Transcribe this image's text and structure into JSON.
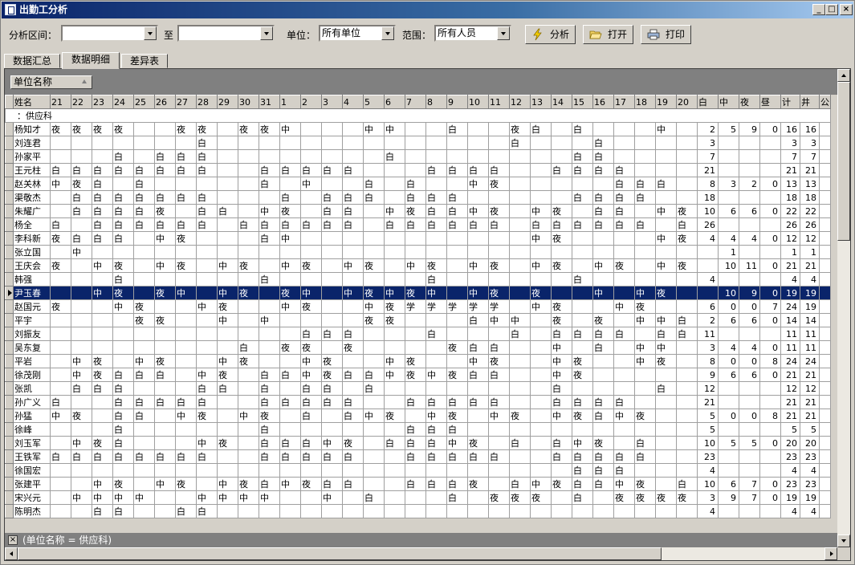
{
  "window": {
    "title": "出勤工分析",
    "minimize": "_",
    "maximize": "□",
    "close": "×"
  },
  "toolbar": {
    "range_label": "分析区间：",
    "range_to": "至",
    "range_start": "",
    "range_end": "",
    "unit_label": "单位：",
    "unit_value": "所有单位",
    "scope_label": "范围：",
    "scope_value": "所有人员",
    "analyze_label": "分析",
    "open_label": "打开",
    "print_label": "打印"
  },
  "tabs": [
    "数据汇总",
    "数据明细",
    "差异表"
  ],
  "active_tab": 1,
  "group": {
    "field": "单位名称",
    "group_row": "：供应科"
  },
  "columns": [
    "姓名",
    "21",
    "22",
    "23",
    "24",
    "25",
    "26",
    "27",
    "28",
    "29",
    "30",
    "31",
    "1",
    "2",
    "3",
    "4",
    "5",
    "6",
    "7",
    "8",
    "9",
    "10",
    "11",
    "12",
    "13",
    "14",
    "15",
    "16",
    "17",
    "18",
    "19",
    "20",
    "白",
    "中",
    "夜",
    "昼",
    "计",
    "井",
    "公"
  ],
  "rows": [
    [
      "杨知才",
      "夜",
      "夜",
      "夜",
      "夜",
      "",
      "",
      "夜",
      "夜",
      "",
      "夜",
      "夜",
      "中",
      "",
      "",
      "",
      "中",
      "中",
      "",
      "",
      "白",
      "",
      "",
      "夜",
      "白",
      "",
      "白",
      "",
      "",
      "",
      "中",
      "",
      "2",
      "5",
      "9",
      "0",
      "16",
      "16",
      ""
    ],
    [
      "刘连君",
      "",
      "",
      "",
      "",
      "",
      "",
      "",
      "白",
      "",
      "",
      "",
      "",
      "",
      "",
      "",
      "",
      "",
      "",
      "",
      "",
      "",
      "",
      "白",
      "",
      "",
      "",
      "白",
      "",
      "",
      "",
      "",
      "3",
      "",
      "",
      "",
      "3",
      "3",
      ""
    ],
    [
      "孙家平",
      "",
      "",
      "",
      "白",
      "",
      "白",
      "白",
      "白",
      "",
      "",
      "",
      "",
      "",
      "",
      "",
      "",
      "白",
      "",
      "",
      "",
      "",
      "",
      "",
      "",
      "",
      "白",
      "白",
      "",
      "",
      "",
      "",
      "7",
      "",
      "",
      "",
      "7",
      "7",
      ""
    ],
    [
      "王元柱",
      "白",
      "白",
      "白",
      "白",
      "白",
      "白",
      "白",
      "白",
      "",
      "",
      "白",
      "白",
      "白",
      "白",
      "白",
      "",
      "",
      "",
      "白",
      "白",
      "白",
      "白",
      "",
      "",
      "白",
      "白",
      "白",
      "白",
      "",
      "",
      "",
      "21",
      "",
      "",
      "",
      "21",
      "21",
      ""
    ],
    [
      "赵关林",
      "中",
      "夜",
      "白",
      "",
      "白",
      "",
      "",
      "",
      "",
      "",
      "白",
      "",
      "中",
      "",
      "",
      "白",
      "",
      "白",
      "",
      "",
      "中",
      "夜",
      "",
      "",
      "",
      "",
      "",
      "白",
      "白",
      "白",
      "",
      "8",
      "3",
      "2",
      "0",
      "13",
      "13",
      ""
    ],
    [
      "渠敬杰",
      "",
      "白",
      "白",
      "白",
      "白",
      "白",
      "白",
      "白",
      "",
      "",
      "",
      "白",
      "",
      "白",
      "白",
      "白",
      "",
      "白",
      "白",
      "白",
      "",
      "",
      "",
      "",
      "",
      "白",
      "白",
      "白",
      "白",
      "",
      "",
      "18",
      "",
      "",
      "",
      "18",
      "18",
      ""
    ],
    [
      "朱耀广",
      "",
      "白",
      "白",
      "白",
      "白",
      "夜",
      "",
      "白",
      "白",
      "",
      "中",
      "夜",
      "",
      "白",
      "白",
      "",
      "中",
      "夜",
      "白",
      "白",
      "中",
      "夜",
      "",
      "中",
      "夜",
      "",
      "白",
      "白",
      "",
      "中",
      "夜",
      "10",
      "6",
      "6",
      "0",
      "22",
      "22",
      ""
    ],
    [
      "杨全",
      "白",
      "",
      "白",
      "白",
      "白",
      "白",
      "白",
      "白",
      "",
      "白",
      "白",
      "白",
      "白",
      "白",
      "白",
      "",
      "白",
      "白",
      "白",
      "白",
      "白",
      "白",
      "",
      "白",
      "白",
      "白",
      "白",
      "白",
      "白",
      "",
      "白",
      "26",
      "",
      "",
      "",
      "26",
      "26",
      ""
    ],
    [
      "李科新",
      "夜",
      "白",
      "白",
      "白",
      "",
      "中",
      "夜",
      "",
      "",
      "",
      "白",
      "中",
      "",
      "",
      "",
      "",
      "",
      "",
      "",
      "",
      "",
      "",
      "",
      "中",
      "夜",
      "",
      "",
      "",
      "",
      "中",
      "夜",
      "4",
      "4",
      "4",
      "0",
      "12",
      "12",
      ""
    ],
    [
      "张立国",
      "",
      "中",
      "",
      "",
      "",
      "",
      "",
      "",
      "",
      "",
      "",
      "",
      "",
      "",
      "",
      "",
      "",
      "",
      "",
      "",
      "",
      "",
      "",
      "",
      "",
      "",
      "",
      "",
      "",
      "",
      "",
      "",
      "1",
      "",
      "",
      "1",
      "1",
      ""
    ],
    [
      "王庆会",
      "夜",
      "",
      "中",
      "夜",
      "",
      "中",
      "夜",
      "",
      "中",
      "夜",
      "",
      "中",
      "夜",
      "",
      "中",
      "夜",
      "",
      "中",
      "夜",
      "",
      "中",
      "夜",
      "",
      "中",
      "夜",
      "",
      "中",
      "夜",
      "",
      "中",
      "夜",
      "",
      "10",
      "11",
      "0",
      "21",
      "21",
      ""
    ],
    [
      "韩强",
      "",
      "",
      "",
      "白",
      "",
      "",
      "",
      "",
      "",
      "",
      "白",
      "",
      "",
      "",
      "",
      "",
      "",
      "",
      "白",
      "",
      "",
      "",
      "",
      "",
      "",
      "白",
      "",
      "",
      "",
      "",
      "",
      "4",
      "",
      "",
      "",
      "4",
      "4",
      ""
    ],
    [
      "尹玉春",
      "",
      "",
      "中",
      "夜",
      "",
      "夜",
      "中",
      "",
      "中",
      "夜",
      "",
      "夜",
      "中",
      "",
      "中",
      "夜",
      "中",
      "夜",
      "中",
      "",
      "中",
      "夜",
      "",
      "夜",
      "",
      "",
      "中",
      "",
      "中",
      "夜",
      "",
      "",
      "10",
      "9",
      "0",
      "19",
      "19",
      ""
    ],
    [
      "赵国元",
      "夜",
      "",
      "",
      "中",
      "夜",
      "",
      "",
      "中",
      "夜",
      "",
      "",
      "中",
      "夜",
      "",
      "",
      "中",
      "夜",
      "学",
      "学",
      "学",
      "学",
      "学",
      "",
      "中",
      "夜",
      "",
      "",
      "中",
      "夜",
      "",
      "",
      "6",
      "0",
      "0",
      "7",
      "24",
      "19",
      ""
    ],
    [
      "平宇",
      "",
      "",
      "",
      "",
      "夜",
      "夜",
      "",
      "",
      "中",
      "",
      "中",
      "",
      "",
      "",
      "",
      "夜",
      "夜",
      "",
      "",
      "",
      "白",
      "中",
      "中",
      "",
      "夜",
      "",
      "夜",
      "",
      "中",
      "中",
      "白",
      "2",
      "6",
      "6",
      "0",
      "14",
      "14",
      ""
    ],
    [
      "刘振友",
      "",
      "",
      "",
      "",
      "",
      "",
      "",
      "",
      "",
      "",
      "",
      "",
      "白",
      "白",
      "白",
      "",
      "",
      "",
      "白",
      "",
      "",
      "",
      "白",
      "",
      "白",
      "白",
      "白",
      "白",
      "",
      "白",
      "白",
      "11",
      "",
      "",
      "",
      "11",
      "11",
      ""
    ],
    [
      "吴东复",
      "",
      "",
      "",
      "",
      "",
      "",
      "",
      "",
      "",
      "白",
      "",
      "夜",
      "夜",
      "",
      "夜",
      "",
      "",
      "",
      "",
      "夜",
      "白",
      "白",
      "",
      "",
      "中",
      "",
      "白",
      "",
      "中",
      "中",
      "",
      "3",
      "4",
      "4",
      "0",
      "11",
      "11",
      ""
    ],
    [
      "平岩",
      "",
      "中",
      "夜",
      "",
      "中",
      "夜",
      "",
      "",
      "中",
      "夜",
      "",
      "",
      "中",
      "夜",
      "",
      "",
      "中",
      "夜",
      "",
      "",
      "中",
      "夜",
      "",
      "",
      "中",
      "夜",
      "",
      "",
      "中",
      "夜",
      "",
      "8",
      "0",
      "0",
      "8",
      "24",
      "24",
      ""
    ],
    [
      "徐茂刚",
      "",
      "中",
      "夜",
      "白",
      "白",
      "白",
      "",
      "中",
      "夜",
      "",
      "白",
      "白",
      "中",
      "夜",
      "白",
      "白",
      "中",
      "夜",
      "中",
      "夜",
      "白",
      "白",
      "",
      "",
      "中",
      "夜",
      "",
      "",
      "",
      "",
      "",
      "9",
      "6",
      "6",
      "0",
      "21",
      "21",
      ""
    ],
    [
      "张凯",
      "",
      "白",
      "白",
      "白",
      "",
      "",
      "",
      "白",
      "白",
      "",
      "白",
      "",
      "白",
      "白",
      "",
      "白",
      "",
      "",
      "",
      "",
      "",
      "",
      "",
      "",
      "白",
      "",
      "",
      "",
      "",
      "白",
      "",
      "12",
      "",
      "",
      "",
      "12",
      "12",
      ""
    ],
    [
      "孙广义",
      "白",
      "",
      "",
      "白",
      "白",
      "白",
      "白",
      "白",
      "",
      "",
      "白",
      "白",
      "白",
      "白",
      "白",
      "",
      "",
      "白",
      "白",
      "白",
      "白",
      "白",
      "",
      "",
      "白",
      "白",
      "白",
      "白",
      "",
      "",
      "",
      "21",
      "",
      "",
      "",
      "21",
      "21",
      ""
    ],
    [
      "孙猛",
      "中",
      "夜",
      "",
      "白",
      "白",
      "",
      "中",
      "夜",
      "",
      "中",
      "夜",
      "",
      "白",
      "",
      "白",
      "中",
      "夜",
      "",
      "中",
      "夜",
      "",
      "中",
      "夜",
      "",
      "中",
      "夜",
      "白",
      "中",
      "夜",
      "",
      "",
      "5",
      "0",
      "0",
      "8",
      "21",
      "21",
      ""
    ],
    [
      "徐峰",
      "",
      "",
      "",
      "白",
      "",
      "",
      "",
      "",
      "",
      "",
      "白",
      "",
      "",
      "",
      "",
      "",
      "",
      "白",
      "白",
      "白",
      "",
      "",
      "",
      "",
      "",
      "",
      "",
      "",
      "",
      "",
      "",
      "5",
      "",
      "",
      "",
      "5",
      "5",
      ""
    ],
    [
      "刘玉军",
      "",
      "中",
      "夜",
      "白",
      "",
      "",
      "",
      "中",
      "夜",
      "",
      "白",
      "白",
      "白",
      "中",
      "夜",
      "",
      "白",
      "白",
      "白",
      "中",
      "夜",
      "",
      "白",
      "",
      "白",
      "中",
      "夜",
      "",
      "白",
      "",
      "",
      "10",
      "5",
      "5",
      "0",
      "20",
      "20",
      ""
    ],
    [
      "王铁军",
      "白",
      "白",
      "白",
      "白",
      "白",
      "白",
      "白",
      "白",
      "",
      "",
      "白",
      "白",
      "白",
      "白",
      "白",
      "",
      "",
      "白",
      "白",
      "白",
      "白",
      "白",
      "",
      "",
      "白",
      "白",
      "白",
      "白",
      "白",
      "",
      "",
      "23",
      "",
      "",
      "",
      "23",
      "23",
      ""
    ],
    [
      "徐国宏",
      "",
      "",
      "",
      "",
      "",
      "",
      "",
      "",
      "",
      "",
      "",
      "",
      "",
      "",
      "",
      "",
      "",
      "",
      "",
      "",
      "",
      "",
      "",
      "",
      "",
      "白",
      "白",
      "白",
      "",
      "",
      "",
      "4",
      "",
      "",
      "",
      "4",
      "4",
      ""
    ],
    [
      "张建平",
      "",
      "",
      "中",
      "夜",
      "",
      "中",
      "夜",
      "",
      "中",
      "夜",
      "白",
      "中",
      "夜",
      "白",
      "白",
      "",
      "",
      "白",
      "白",
      "白",
      "夜",
      "",
      "白",
      "中",
      "夜",
      "白",
      "白",
      "中",
      "夜",
      "",
      "白",
      "10",
      "6",
      "7",
      "0",
      "23",
      "23",
      ""
    ],
    [
      "宋兴元",
      "",
      "中",
      "中",
      "中",
      "中",
      "",
      "",
      "中",
      "中",
      "中",
      "中",
      "",
      "",
      "中",
      "",
      "白",
      "",
      "",
      "",
      "白",
      "",
      "夜",
      "夜",
      "夜",
      "",
      "白",
      "",
      "夜",
      "夜",
      "夜",
      "夜",
      "3",
      "9",
      "7",
      "0",
      "19",
      "19",
      ""
    ],
    [
      "陈明杰",
      "",
      "",
      "白",
      "白",
      "",
      "",
      "白",
      "白",
      "",
      "",
      "",
      "",
      "",
      "",
      "",
      "",
      "",
      "",
      "",
      "",
      "",
      "",
      "",
      "",
      "",
      "",
      "",
      "",
      "",
      "",
      "",
      "4",
      "",
      "",
      "",
      "4",
      "4",
      ""
    ]
  ],
  "selected_row": 12,
  "filter_text": "(单位名称 = 供应科)",
  "filter_close": "×"
}
